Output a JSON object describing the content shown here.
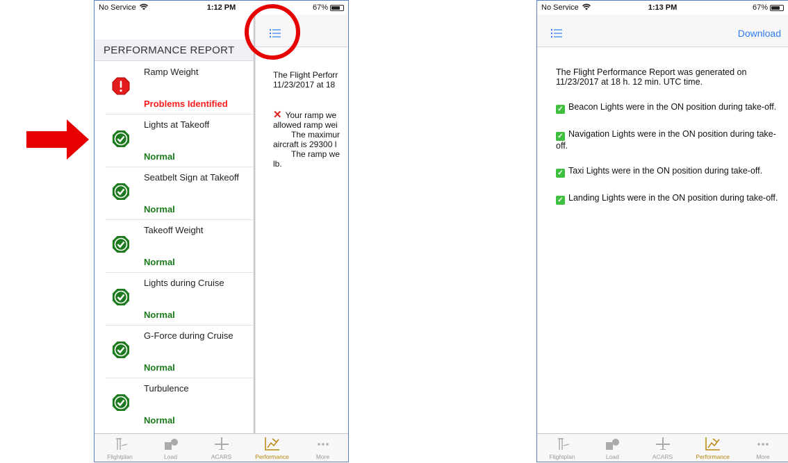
{
  "left_phone": {
    "status_bar": {
      "carrier": "No Service",
      "time": "1:12 PM",
      "battery": "67%"
    },
    "sidebar": {
      "title": "PERFORMANCE REPORT",
      "items": [
        {
          "label": "Ramp Weight",
          "status": "Problems Identified",
          "state": "problem"
        },
        {
          "label": "Lights at Takeoff",
          "status": "Normal",
          "state": "normal"
        },
        {
          "label": "Seatbelt Sign at Takeoff",
          "status": "Normal",
          "state": "normal"
        },
        {
          "label": "Takeoff Weight",
          "status": "Normal",
          "state": "normal"
        },
        {
          "label": "Lights during Cruise",
          "status": "Normal",
          "state": "normal"
        },
        {
          "label": "G-Force during Cruise",
          "status": "Normal",
          "state": "normal"
        },
        {
          "label": "Turbulence",
          "status": "Normal",
          "state": "normal"
        }
      ]
    },
    "detail": {
      "line1": "The Flight Perforr",
      "line2": "11/23/2017 at 18",
      "issue_line1": "Your ramp we",
      "issue_line2": "allowed ramp wei",
      "issue_line3": "The maximur",
      "issue_line4": "aircraft is 29300 l",
      "issue_line5": "The ramp we",
      "issue_line6": "lb."
    }
  },
  "right_phone": {
    "status_bar": {
      "carrier": "No Service",
      "time": "1:13 PM",
      "battery": "67%"
    },
    "nav": {
      "download_label": "Download"
    },
    "report": {
      "intro": "The Flight Performance Report was generated on 11/23/2017 at 18 h. 12 min. UTC time.",
      "findings": [
        "Beacon Lights were in the ON position during take-off.",
        "Navigation Lights were in the ON position during take-off.",
        "Taxi Lights were in the ON position during take-off.",
        "Landing Lights were in the ON position during take-off."
      ]
    }
  },
  "tabbar": {
    "tabs": [
      {
        "label": "Flightplan",
        "icon": "flightplan-icon"
      },
      {
        "label": "Load",
        "icon": "load-icon"
      },
      {
        "label": "ACARS",
        "icon": "acars-icon"
      },
      {
        "label": "Performance",
        "icon": "performance-icon",
        "active": true
      },
      {
        "label": "More",
        "icon": "more-icon"
      }
    ]
  },
  "colors": {
    "accent": "#2f7bf5",
    "normal": "#1a7a1a",
    "problem": "#ff1a1a",
    "annotation": "#e60000",
    "active_tab": "#b8860b"
  }
}
